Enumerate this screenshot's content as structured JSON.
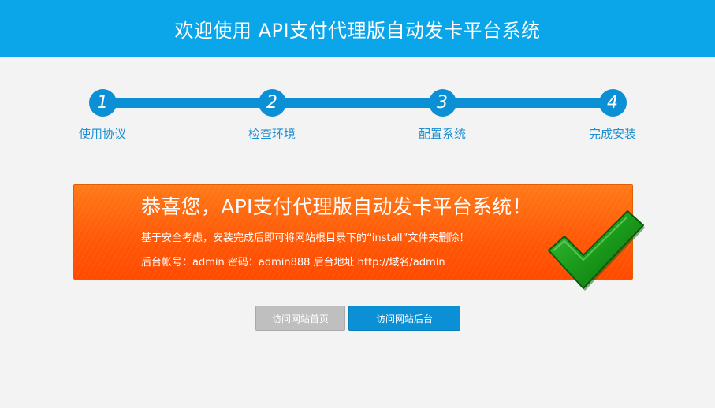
{
  "header": {
    "title": "欢迎使用 API支付代理版自动发卡平台系统"
  },
  "steps": [
    {
      "number": "1",
      "label": "使用协议"
    },
    {
      "number": "2",
      "label": "检查环境"
    },
    {
      "number": "3",
      "label": "配置系统"
    },
    {
      "number": "4",
      "label": "完成安装"
    }
  ],
  "banner": {
    "title": "恭喜您，API支付代理版自动发卡平台系统！",
    "notice": "基于安全考虑，安装完成后即可将网站根目录下的“install”文件夹删除！",
    "credentials": "后台帐号：admin 密码：admin888 后台地址 http://域名/admin"
  },
  "buttons": {
    "home_label": "访问网站首页",
    "admin_label": "访问网站后台"
  },
  "colors": {
    "header_bg": "#0ba6ea",
    "step_accent": "#0b8fd5",
    "banner_orange": "#ff5a08",
    "check_green": "#1a9a1a"
  },
  "icons": {
    "success": "check-mark-icon"
  }
}
